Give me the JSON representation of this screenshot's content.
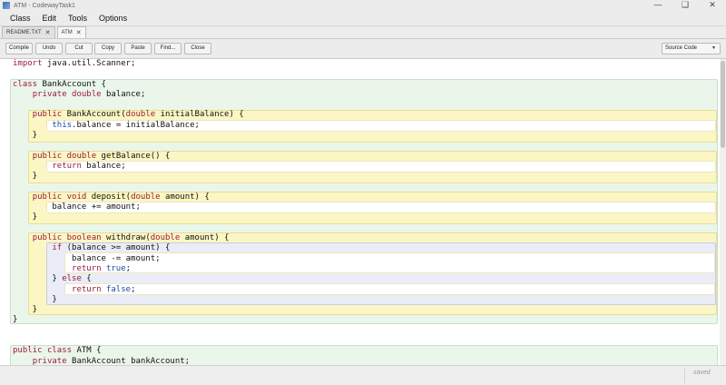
{
  "window": {
    "title": "ATM - CodewayTask1"
  },
  "menu": [
    "Class",
    "Edit",
    "Tools",
    "Options"
  ],
  "tabs": [
    {
      "label": "README.TXT"
    },
    {
      "label": "ATM"
    }
  ],
  "toolbar": {
    "buttons": [
      "Compile",
      "Undo",
      "Cut",
      "Copy",
      "Paste",
      "Find...",
      "Close"
    ],
    "view_select": "Source Code"
  },
  "code": {
    "lines": [
      "import java.util.Scanner;",
      "",
      "class BankAccount {",
      "    private double balance;",
      "",
      "    public BankAccount(double initialBalance) {",
      "        this.balance = initialBalance;",
      "    }",
      "",
      "    public double getBalance() {",
      "        return balance;",
      "    }",
      "",
      "    public void deposit(double amount) {",
      "        balance += amount;",
      "    }",
      "",
      "    public boolean withdraw(double amount) {",
      "        if (balance >= amount) {",
      "            balance -= amount;",
      "            return true;",
      "        } else {",
      "            return false;",
      "        }",
      "    }",
      "}",
      "",
      "",
      "public class ATM {",
      "    private BankAccount bankAccount;"
    ]
  },
  "status": {
    "text": "saved"
  },
  "colors": {
    "keyword": "#9a1a3a",
    "keyword_literal": "#1a4aa8",
    "class_scope": "#ebf6eb",
    "method_scope": "#fbf6c4",
    "block_scope": "#eaedf7"
  }
}
